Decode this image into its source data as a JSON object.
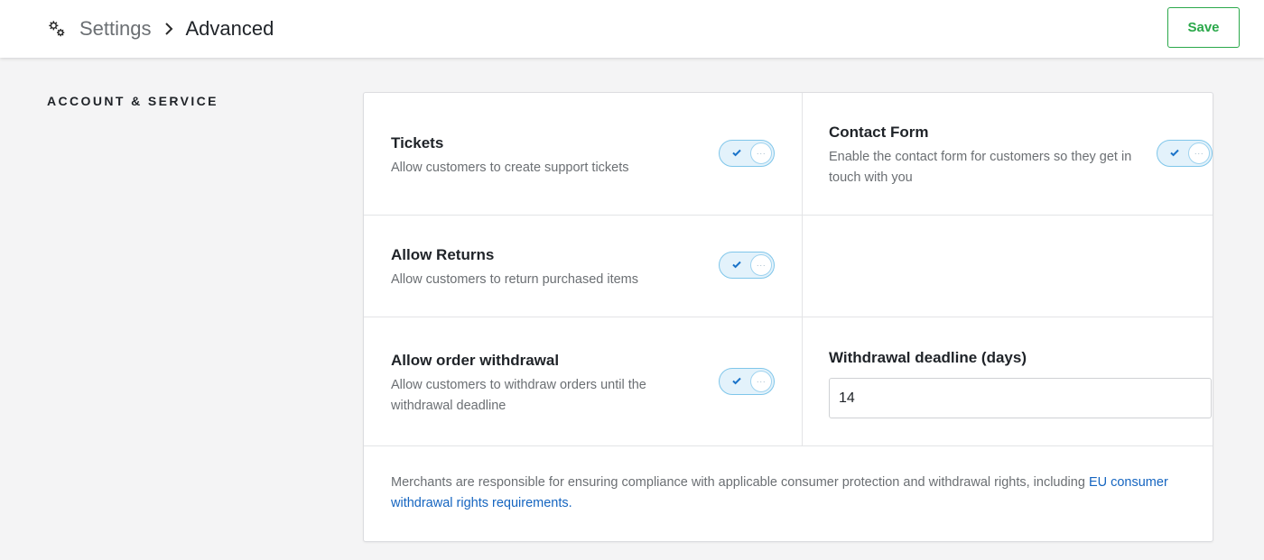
{
  "header": {
    "icon": "settings-gear-icon",
    "breadcrumb_root": "Settings",
    "breadcrumb_separator_icon": "chevron-right-icon",
    "breadcrumb_current": "Advanced",
    "save_label": "Save",
    "save_color": "#2aa84a"
  },
  "section": {
    "title": "ACCOUNT & SERVICE"
  },
  "settings": {
    "tickets": {
      "title": "Tickets",
      "description": "Allow customers to create support tickets",
      "enabled": true
    },
    "contact_form": {
      "title": "Contact Form",
      "description": "Enable the contact form for customers so they get in touch with you",
      "enabled": true
    },
    "allow_returns": {
      "title": "Allow Returns",
      "description": "Allow customers to return purchased items",
      "enabled": true
    },
    "order_withdrawal": {
      "title": "Allow order withdrawal",
      "description": "Allow customers to withdraw orders until the withdrawal deadline",
      "enabled": true
    },
    "withdrawal_deadline": {
      "label": "Withdrawal deadline (days)",
      "value": "14"
    }
  },
  "footer": {
    "note": "Merchants are responsible for ensuring compliance with applicable consumer protection and withdrawal rights, including ",
    "link_text": "EU consumer withdrawal rights requirements",
    "after_link": ".",
    "link_color": "#1565c0"
  },
  "toggle_colors": {
    "track": "#e3f2fb",
    "border": "#7fc6ea",
    "check": "#1a73c9"
  }
}
